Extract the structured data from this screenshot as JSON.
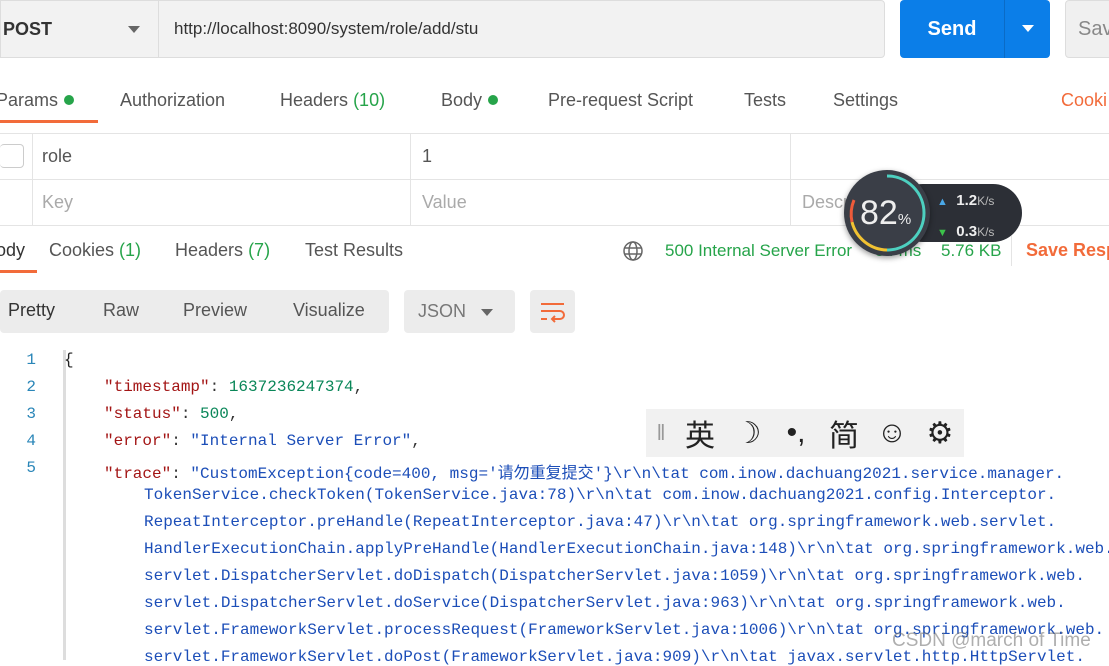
{
  "request": {
    "method": "POST",
    "url": "http://localhost:8090/system/role/add/stu",
    "send_label": "Send",
    "save_label": "Sav"
  },
  "request_tabs": [
    {
      "label": "Params",
      "dot": true
    },
    {
      "label": "Authorization"
    },
    {
      "label": "Headers",
      "count": "(10)"
    },
    {
      "label": "Body",
      "dot": true
    },
    {
      "label": "Pre-request Script"
    },
    {
      "label": "Tests"
    },
    {
      "label": "Settings"
    }
  ],
  "cookies_link": "Cooki",
  "params": {
    "rows": [
      {
        "key": "role",
        "value": "1",
        "description": ""
      }
    ],
    "placeholder": {
      "key": "Key",
      "value": "Value",
      "description": "Description"
    }
  },
  "response_tabs": [
    {
      "label": "ody"
    },
    {
      "label": "Cookies",
      "count": "(1)"
    },
    {
      "label": "Headers",
      "count": "(7)"
    },
    {
      "label": "Test Results"
    }
  ],
  "response_status": {
    "status": "500 Internal Server Error",
    "time": "84 ms",
    "size": "5.76 KB",
    "save_label": "Save Resp"
  },
  "view_modes": [
    "Pretty",
    "Raw",
    "Preview",
    "Visualize"
  ],
  "format": "JSON",
  "code_lines": [
    {
      "n": "1",
      "t": "{"
    },
    {
      "n": "2",
      "k": "\"timestamp\"",
      "v": "1637236247374",
      "type": "n"
    },
    {
      "n": "3",
      "k": "\"status\"",
      "v": "500",
      "type": "n"
    },
    {
      "n": "4",
      "k": "\"error\"",
      "v": "\"Internal Server Error\"",
      "type": "s"
    },
    {
      "n": "5",
      "k": "\"trace\"",
      "v": "\"CustomException{code=400, msg='请勿重复提交'}\\r\\n\\tat com.inow.dachuang2021.service.manager.",
      "type": "s"
    }
  ],
  "trace_cont": [
    "TokenService.checkToken(TokenService.java:78)\\r\\n\\tat com.inow.dachuang2021.config.Interceptor.",
    "RepeatInterceptor.preHandle(RepeatInterceptor.java:47)\\r\\n\\tat org.springframework.web.servlet.",
    "HandlerExecutionChain.applyPreHandle(HandlerExecutionChain.java:148)\\r\\n\\tat org.springframework.web.",
    "servlet.DispatcherServlet.doDispatch(DispatcherServlet.java:1059)\\r\\n\\tat org.springframework.web.",
    "servlet.DispatcherServlet.doService(DispatcherServlet.java:963)\\r\\n\\tat org.springframework.web.",
    "servlet.FrameworkServlet.processRequest(FrameworkServlet.java:1006)\\r\\n\\tat org.springframework.web.",
    "servlet.FrameworkServlet.doPost(FrameworkServlet.java:909)\\r\\n\\tat javax.servlet.http.HttpServlet."
  ],
  "net_monitor": {
    "percent": "82",
    "unit": "%",
    "up": "1.2",
    "down": "0.3",
    "rate_unit": "K/s"
  },
  "ime_toolbar": {
    "items": [
      "英",
      "☽",
      "•,",
      "简",
      "☺",
      "⚙"
    ]
  },
  "watermark": "CSDN @march of Time",
  "colors": {
    "accent": "#f26b3a",
    "send": "#0b7ee8",
    "success": "#26a44a"
  }
}
